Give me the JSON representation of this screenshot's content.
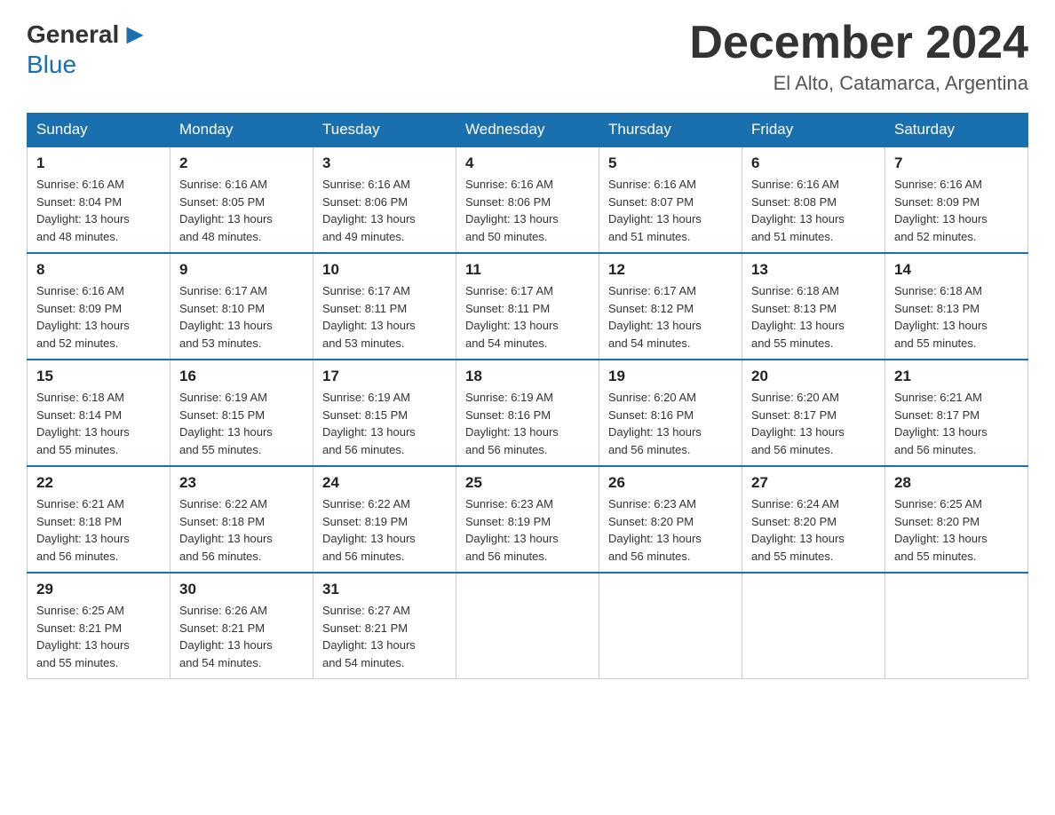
{
  "logo": {
    "general": "General",
    "blue": "Blue"
  },
  "header": {
    "month": "December 2024",
    "location": "El Alto, Catamarca, Argentina"
  },
  "days_of_week": [
    "Sunday",
    "Monday",
    "Tuesday",
    "Wednesday",
    "Thursday",
    "Friday",
    "Saturday"
  ],
  "weeks": [
    [
      {
        "date": "1",
        "sunrise": "6:16 AM",
        "sunset": "8:04 PM",
        "daylight": "13 hours and 48 minutes."
      },
      {
        "date": "2",
        "sunrise": "6:16 AM",
        "sunset": "8:05 PM",
        "daylight": "13 hours and 48 minutes."
      },
      {
        "date": "3",
        "sunrise": "6:16 AM",
        "sunset": "8:06 PM",
        "daylight": "13 hours and 49 minutes."
      },
      {
        "date": "4",
        "sunrise": "6:16 AM",
        "sunset": "8:06 PM",
        "daylight": "13 hours and 50 minutes."
      },
      {
        "date": "5",
        "sunrise": "6:16 AM",
        "sunset": "8:07 PM",
        "daylight": "13 hours and 51 minutes."
      },
      {
        "date": "6",
        "sunrise": "6:16 AM",
        "sunset": "8:08 PM",
        "daylight": "13 hours and 51 minutes."
      },
      {
        "date": "7",
        "sunrise": "6:16 AM",
        "sunset": "8:09 PM",
        "daylight": "13 hours and 52 minutes."
      }
    ],
    [
      {
        "date": "8",
        "sunrise": "6:16 AM",
        "sunset": "8:09 PM",
        "daylight": "13 hours and 52 minutes."
      },
      {
        "date": "9",
        "sunrise": "6:17 AM",
        "sunset": "8:10 PM",
        "daylight": "13 hours and 53 minutes."
      },
      {
        "date": "10",
        "sunrise": "6:17 AM",
        "sunset": "8:11 PM",
        "daylight": "13 hours and 53 minutes."
      },
      {
        "date": "11",
        "sunrise": "6:17 AM",
        "sunset": "8:11 PM",
        "daylight": "13 hours and 54 minutes."
      },
      {
        "date": "12",
        "sunrise": "6:17 AM",
        "sunset": "8:12 PM",
        "daylight": "13 hours and 54 minutes."
      },
      {
        "date": "13",
        "sunrise": "6:18 AM",
        "sunset": "8:13 PM",
        "daylight": "13 hours and 55 minutes."
      },
      {
        "date": "14",
        "sunrise": "6:18 AM",
        "sunset": "8:13 PM",
        "daylight": "13 hours and 55 minutes."
      }
    ],
    [
      {
        "date": "15",
        "sunrise": "6:18 AM",
        "sunset": "8:14 PM",
        "daylight": "13 hours and 55 minutes."
      },
      {
        "date": "16",
        "sunrise": "6:19 AM",
        "sunset": "8:15 PM",
        "daylight": "13 hours and 55 minutes."
      },
      {
        "date": "17",
        "sunrise": "6:19 AM",
        "sunset": "8:15 PM",
        "daylight": "13 hours and 56 minutes."
      },
      {
        "date": "18",
        "sunrise": "6:19 AM",
        "sunset": "8:16 PM",
        "daylight": "13 hours and 56 minutes."
      },
      {
        "date": "19",
        "sunrise": "6:20 AM",
        "sunset": "8:16 PM",
        "daylight": "13 hours and 56 minutes."
      },
      {
        "date": "20",
        "sunrise": "6:20 AM",
        "sunset": "8:17 PM",
        "daylight": "13 hours and 56 minutes."
      },
      {
        "date": "21",
        "sunrise": "6:21 AM",
        "sunset": "8:17 PM",
        "daylight": "13 hours and 56 minutes."
      }
    ],
    [
      {
        "date": "22",
        "sunrise": "6:21 AM",
        "sunset": "8:18 PM",
        "daylight": "13 hours and 56 minutes."
      },
      {
        "date": "23",
        "sunrise": "6:22 AM",
        "sunset": "8:18 PM",
        "daylight": "13 hours and 56 minutes."
      },
      {
        "date": "24",
        "sunrise": "6:22 AM",
        "sunset": "8:19 PM",
        "daylight": "13 hours and 56 minutes."
      },
      {
        "date": "25",
        "sunrise": "6:23 AM",
        "sunset": "8:19 PM",
        "daylight": "13 hours and 56 minutes."
      },
      {
        "date": "26",
        "sunrise": "6:23 AM",
        "sunset": "8:20 PM",
        "daylight": "13 hours and 56 minutes."
      },
      {
        "date": "27",
        "sunrise": "6:24 AM",
        "sunset": "8:20 PM",
        "daylight": "13 hours and 55 minutes."
      },
      {
        "date": "28",
        "sunrise": "6:25 AM",
        "sunset": "8:20 PM",
        "daylight": "13 hours and 55 minutes."
      }
    ],
    [
      {
        "date": "29",
        "sunrise": "6:25 AM",
        "sunset": "8:21 PM",
        "daylight": "13 hours and 55 minutes."
      },
      {
        "date": "30",
        "sunrise": "6:26 AM",
        "sunset": "8:21 PM",
        "daylight": "13 hours and 54 minutes."
      },
      {
        "date": "31",
        "sunrise": "6:27 AM",
        "sunset": "8:21 PM",
        "daylight": "13 hours and 54 minutes."
      },
      null,
      null,
      null,
      null
    ]
  ],
  "labels": {
    "sunrise": "Sunrise:",
    "sunset": "Sunset:",
    "daylight": "Daylight:"
  }
}
